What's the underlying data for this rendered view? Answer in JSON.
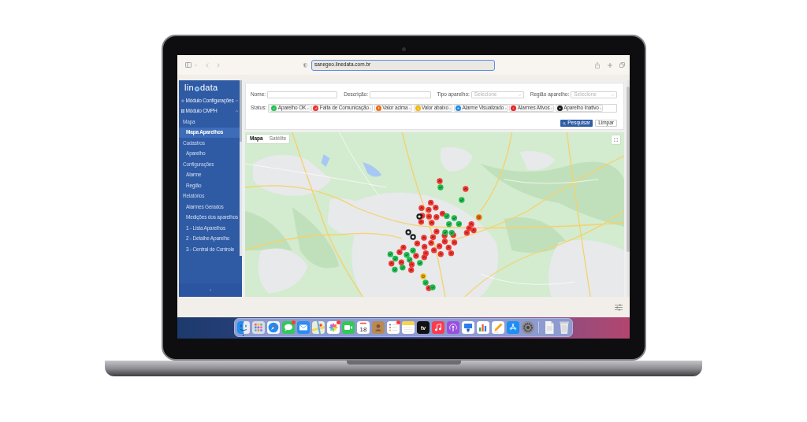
{
  "browser": {
    "url": "sanegeo.linedata.com.br"
  },
  "sidebar": {
    "logo": {
      "left": "lin",
      "right": "data"
    },
    "modules": [
      {
        "label": "Módulo Configurações",
        "expanded": false
      },
      {
        "label": "Módulo CMPH",
        "expanded": true,
        "children": [
          {
            "label": "Mapa",
            "children": [
              {
                "label": "Mapa Aparelhos",
                "selected": true
              }
            ]
          },
          {
            "label": "Cadastros",
            "children": [
              {
                "label": "Aparelho",
                "selected": false
              }
            ]
          },
          {
            "label": "Configurações",
            "children": [
              {
                "label": "Alarme",
                "selected": false
              },
              {
                "label": "Região",
                "selected": false
              }
            ]
          },
          {
            "label": "Relatórios",
            "children": [
              {
                "label": "Alarmes Gerados",
                "selected": false
              },
              {
                "label": "Medições dos aparelhos",
                "selected": false
              },
              {
                "label": "1 - Lista Aparelhos",
                "selected": false
              },
              {
                "label": "2 - Detalhe Aparelho",
                "selected": false
              },
              {
                "label": "3 - Central de Controle",
                "selected": false
              }
            ]
          }
        ]
      }
    ]
  },
  "filters": {
    "fields": [
      {
        "kind": "text",
        "label": "Nome:"
      },
      {
        "kind": "text",
        "label": "Descrição:"
      },
      {
        "kind": "select",
        "label": "Tipo aparelho:",
        "placeholder": "Selecione"
      },
      {
        "kind": "select",
        "label": "Região aparelho:",
        "placeholder": "Selecione"
      }
    ],
    "status": {
      "label": "Status:",
      "chips": [
        {
          "label": "Aparelho OK",
          "color": "#22c04f"
        },
        {
          "label": "Falta de Comunicação",
          "color": "#ef2f2c"
        },
        {
          "label": "Valor acima",
          "color": "#f26b0f"
        },
        {
          "label": "Valor abaixo",
          "color": "#f2b705"
        },
        {
          "label": "Alarme Visualizado",
          "color": "#1e88e5"
        },
        {
          "label": "Alarmes Ativos",
          "color": "#e8231f"
        },
        {
          "label": "Aparelho Inativo",
          "color": "#1a1a1a"
        }
      ]
    },
    "buttons": [
      {
        "kind": "primary",
        "label": "Pesquisar"
      },
      {
        "kind": "secondary",
        "label": "Limpar"
      }
    ]
  },
  "map": {
    "tabs": [
      {
        "label": "Mapa",
        "selected": true
      },
      {
        "label": "Satélite",
        "selected": false
      }
    ]
  },
  "dock": {
    "items": [
      {
        "kind": "finder",
        "running": true,
        "badge": false
      },
      {
        "kind": "launchpad",
        "running": false,
        "badge": false
      },
      {
        "kind": "safari",
        "running": false,
        "badge": false
      },
      {
        "kind": "messages",
        "running": false,
        "badge": true
      },
      {
        "kind": "mail",
        "running": false,
        "badge": false
      },
      {
        "kind": "maps",
        "running": false,
        "badge": false
      },
      {
        "kind": "photos",
        "running": false,
        "badge": true
      },
      {
        "kind": "facetime",
        "running": false,
        "badge": false
      },
      {
        "kind": "calendar",
        "day": "18",
        "running": false,
        "badge": false
      },
      {
        "kind": "contacts",
        "running": false,
        "badge": false
      },
      {
        "kind": "reminders",
        "running": false,
        "badge": true
      },
      {
        "kind": "notes",
        "running": false,
        "badge": false
      },
      {
        "kind": "tv",
        "label": "tv",
        "running": false,
        "badge": false
      },
      {
        "kind": "music",
        "running": false,
        "badge": false
      },
      {
        "kind": "podcasts",
        "running": false,
        "badge": false
      },
      {
        "kind": "keynote",
        "running": false,
        "badge": false
      },
      {
        "kind": "numbers",
        "running": false,
        "badge": false
      },
      {
        "kind": "pages",
        "running": false,
        "badge": false
      },
      {
        "kind": "appstore",
        "running": false,
        "badge": false
      },
      {
        "kind": "settings",
        "running": false,
        "badge": false
      },
      {
        "kind": "separator"
      },
      {
        "kind": "downloads",
        "running": false,
        "badge": false
      },
      {
        "kind": "trash",
        "running": false,
        "badge": false
      }
    ]
  }
}
